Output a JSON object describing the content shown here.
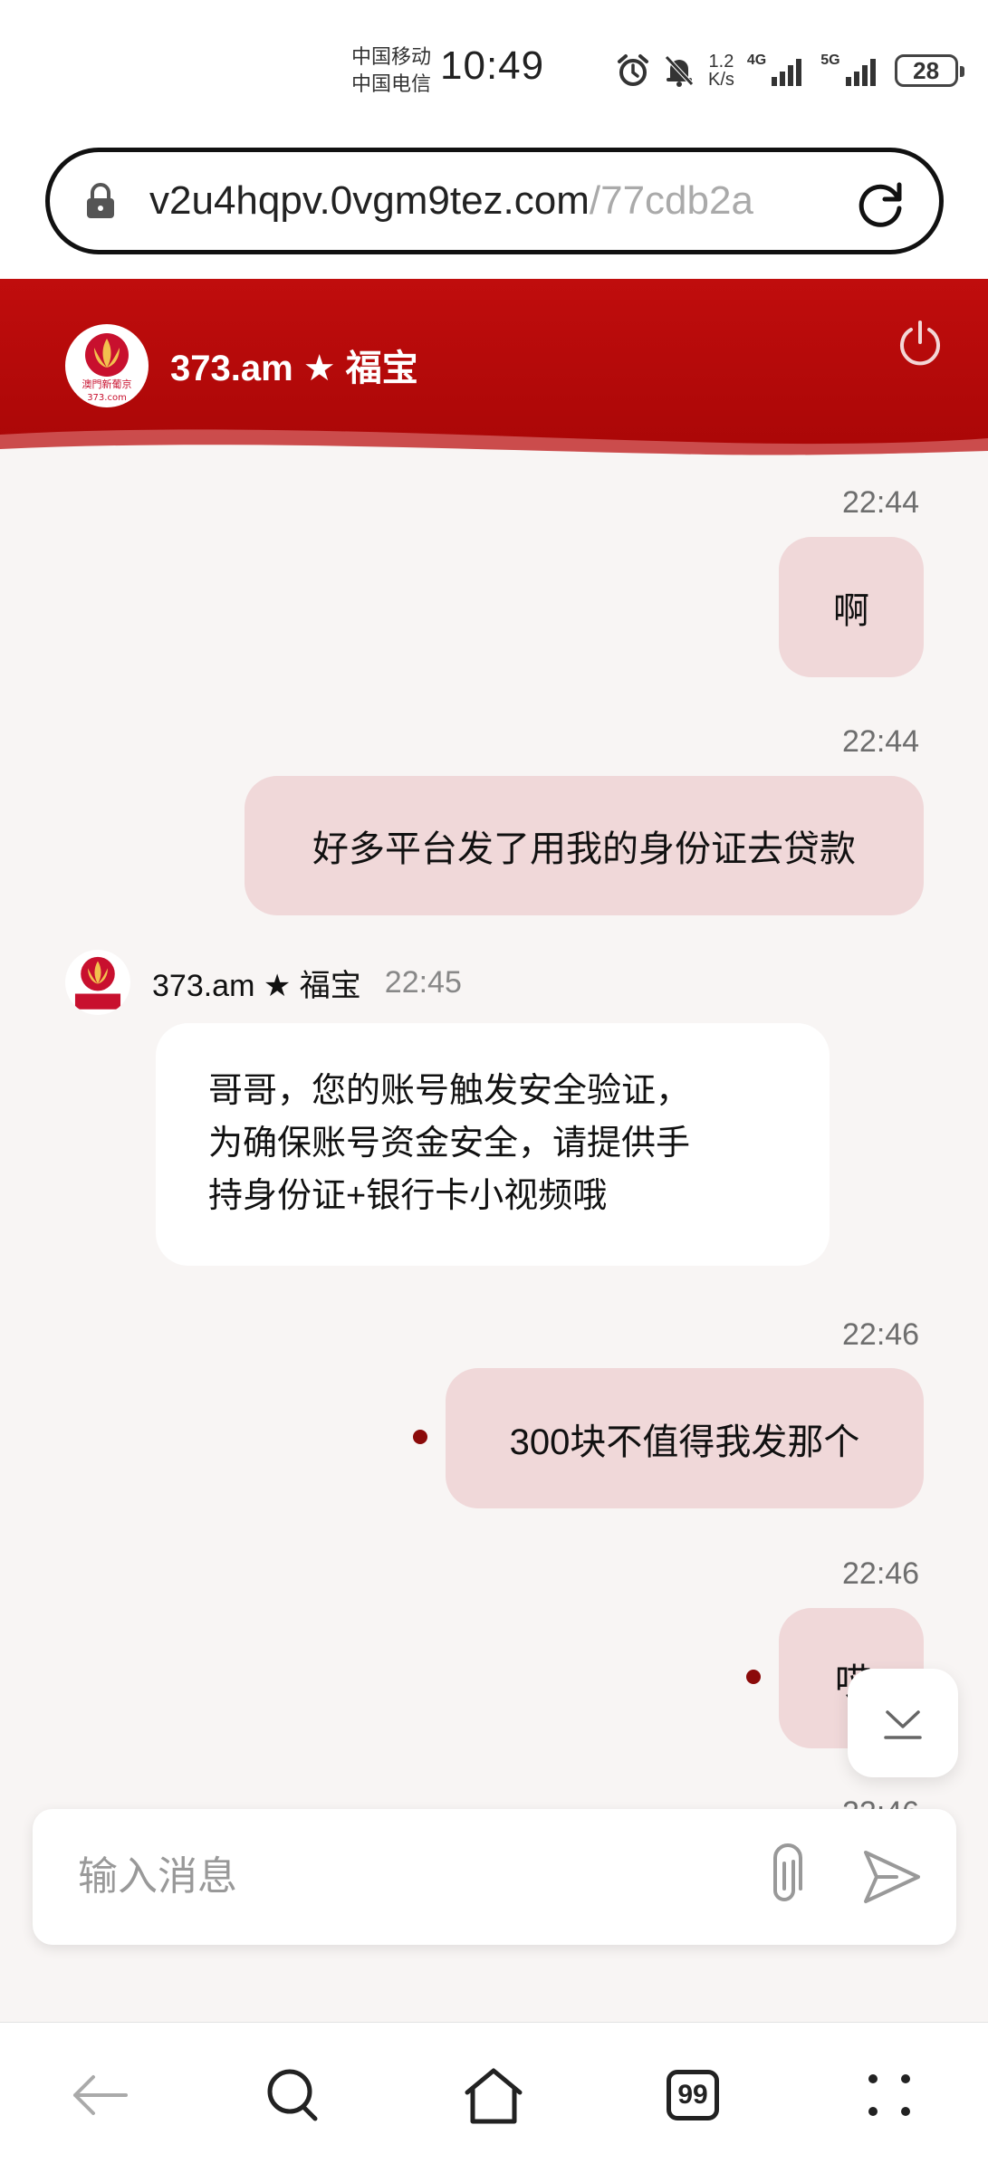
{
  "status_bar": {
    "carrier_1": "中国移动",
    "carrier_2": "中国电信",
    "time": "10:49",
    "net_speed_value": "1.2",
    "net_speed_unit": "K/s",
    "sim1_type": "4G",
    "sim2_type": "5G",
    "battery": "28",
    "icons": [
      "alarm-icon",
      "mute-icon",
      "signal-icon",
      "signal-icon",
      "battery-icon"
    ]
  },
  "browser": {
    "url_host": "v2u4hqpv.0vgm9tez.com",
    "url_path": "/77cdb2a",
    "tabs_count": "99"
  },
  "chat": {
    "title": "373.am ★ 福宝",
    "logo_text": "澳門新葡京",
    "logo_sub": "373.com",
    "messages": [
      {
        "direction": "out",
        "time": "22:44",
        "text": "啊"
      },
      {
        "direction": "out",
        "time": "22:44",
        "text": "好多平台发了用我的身份证去贷款"
      },
      {
        "direction": "in",
        "sender": "373.am ★ 福宝",
        "time": "22:45",
        "lines": [
          "哥哥，您的账号触发安全验证，",
          "为确保账号资金安全，请提供手",
          "持身份证+银行卡小视频哦"
        ]
      },
      {
        "direction": "out",
        "time": "22:46",
        "text": "300块不值得我发那个",
        "unread_dot": true
      },
      {
        "direction": "out",
        "time": "22:46",
        "text": "哎",
        "unread_dot": true
      },
      {
        "direction": "out",
        "time": "22:46",
        "text": ""
      }
    ],
    "composer_placeholder": "输入消息"
  },
  "colors": {
    "header_red": "#b80909",
    "bubble_out": "#f0d8d9",
    "bubble_in": "#ffffff",
    "chat_bg": "#f8f5f4",
    "dot": "#8b0a0a"
  }
}
